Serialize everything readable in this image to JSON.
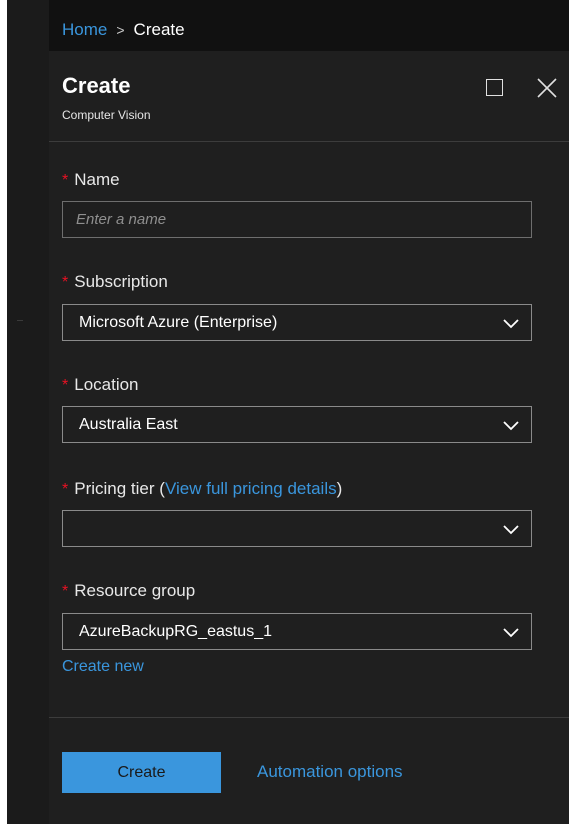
{
  "breadcrumb": {
    "home_label": "Home",
    "separator": ">",
    "current_label": "Create"
  },
  "header": {
    "title": "Create",
    "subtitle": "Computer Vision",
    "maximize_icon": "maximize-icon",
    "close_icon": "close-icon"
  },
  "form": {
    "required_marker": "*",
    "name": {
      "label": "Name",
      "value": "",
      "placeholder": "Enter a name"
    },
    "subscription": {
      "label": "Subscription",
      "selected": "Microsoft Azure (Enterprise)"
    },
    "location": {
      "label": "Location",
      "selected": "Australia East"
    },
    "pricing_tier": {
      "label": "Pricing tier",
      "link_open": "(",
      "link_label": "View full pricing details",
      "link_close": ")",
      "selected": ""
    },
    "resource_group": {
      "label": "Resource group",
      "selected": "AzureBackupRG_eastus_1",
      "create_new_label": "Create new"
    }
  },
  "footer": {
    "create_label": "Create",
    "automation_label": "Automation options"
  },
  "colors": {
    "accent": "#3a96dd",
    "required": "#e81123",
    "panel_bg": "#1f1f1f",
    "page_bg": "#111111"
  }
}
